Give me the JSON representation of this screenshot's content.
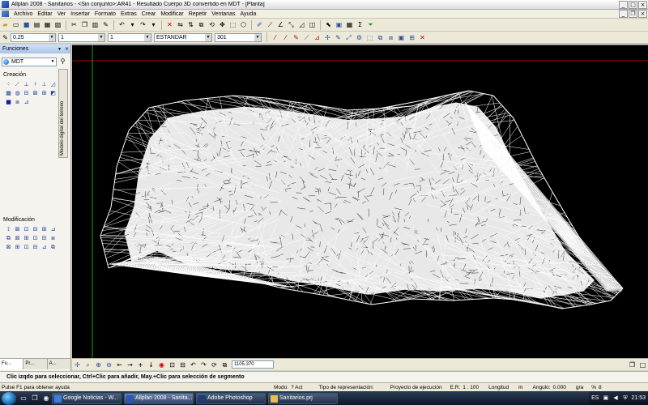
{
  "window": {
    "title": "Allplan 2008 - Sanitarios - <Sin conjunto>:AR41 - Resultado        Cuerpo 3D convertido en MDT - [Planta]"
  },
  "menu": {
    "items": [
      "Archivo",
      "Editar",
      "Ver",
      "Insertar",
      "Formato",
      "Extras",
      "Crear",
      "Modificar",
      "Repetir",
      "Ventanas",
      "Ayuda"
    ]
  },
  "toolbar2": {
    "pen_value": "0.25",
    "line_value": "1",
    "color_value": "1",
    "layer_value": "ESTANDAR",
    "hatch_value": "301"
  },
  "panel": {
    "title": "Funciones",
    "module": "MDT",
    "section_creation": "Creación",
    "section_modification": "Modificación",
    "vertical_tab": "Modelo digital del terreno",
    "tabs": [
      "Fu...",
      "Pr...",
      "A..."
    ]
  },
  "viewnav": {
    "zoom_value": "1105.370"
  },
  "prompt": {
    "text": "Clic izqdo para seleccionar, Ctrl+Clic para añadir, May.+Clic para selección de segmento"
  },
  "status": {
    "help": "Pulse F1 para obtener ayuda",
    "mode_label": "Modo:",
    "mode_value": "? Act",
    "rep_label": "Tipo de representación:",
    "rep_value": "Proyecto de ejecución",
    "scale_label": "E.R:",
    "scale_value": "1 : 100",
    "length_label": "Longitud",
    "length_unit": "m",
    "angle_label": "Angulo:",
    "angle_value": "0.000",
    "angle_unit": "gra",
    "pct_label": "%",
    "pct_value": "8"
  },
  "taskbar": {
    "buttons": [
      {
        "label": "Google Noticias - W...",
        "icon_color": "#3b7ee0"
      },
      {
        "label": "Allplan 2008 - Sanita...",
        "icon_color": "#2a58b8"
      },
      {
        "label": "Adobe Photoshop",
        "icon_color": "#1d3c73"
      },
      {
        "label": "Sanitarios.prj",
        "icon_color": "#e5c14b"
      }
    ],
    "lang": "ES",
    "clock": "21:53"
  },
  "colors": {
    "viewport_bg": "#000000",
    "mesh": "#ffffff",
    "grid_line": "#b00000",
    "crosshair": "#1aa21a"
  }
}
